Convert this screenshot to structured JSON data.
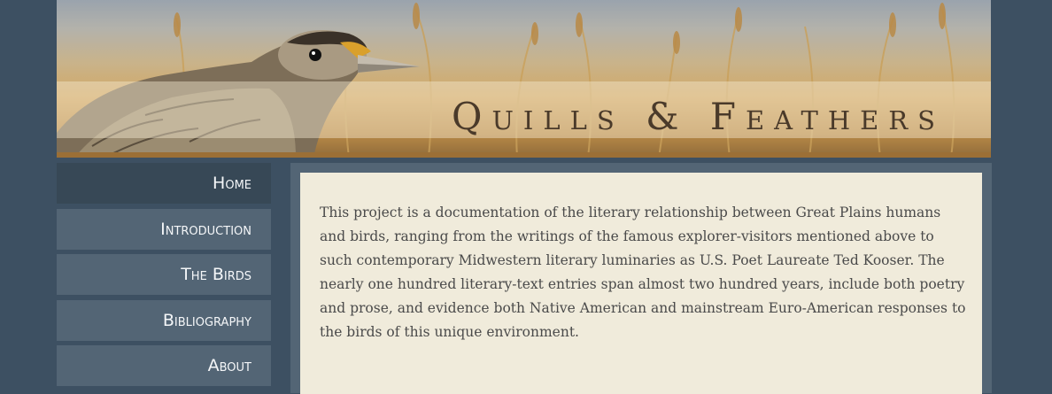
{
  "site": {
    "title": "Quills & Feathers"
  },
  "nav": {
    "items": [
      {
        "label": "Home",
        "active": true
      },
      {
        "label": "Introduction",
        "active": false
      },
      {
        "label": "The Birds",
        "active": false
      },
      {
        "label": "Bibliography",
        "active": false
      },
      {
        "label": "About",
        "active": false
      }
    ]
  },
  "main": {
    "intro_text": "This project is a documentation of the literary relationship between Great Plains humans and birds, ranging from the writings of the famous explorer-visitors mentioned above to such contemporary Midwestern literary luminaries as U.S. Poet Laureate Ted Kooser. The nearly one hundred literary-text entries span almost two hundred years, include both poetry and prose, and evidence both Native American and mainstream Euro-American responses to the birds of this unique environment."
  },
  "colors": {
    "background": "#3d5062",
    "nav_item": "#536575",
    "nav_active": "#374856",
    "panel": "#f0ebdb",
    "text": "#4a4a4a"
  },
  "icons": {
    "banner_image": "meadowlark-in-wheat-field"
  }
}
